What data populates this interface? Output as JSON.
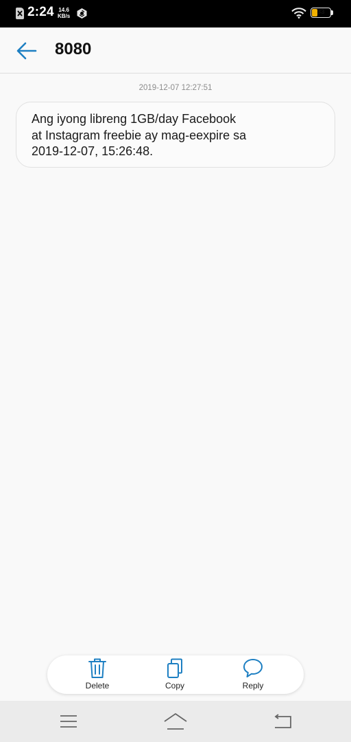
{
  "status_bar": {
    "time": "2:24",
    "speed_value": "14.6",
    "speed_unit": "KB/s",
    "battery_level": "33",
    "battery_fraction": 0.33,
    "battery_color": "#f0b100",
    "icons": [
      "sim-card-icon",
      "app-notification-icon",
      "wifi-icon",
      "battery-icon"
    ]
  },
  "header": {
    "title": "8080",
    "back_icon": "arrow-left-icon",
    "accent_color": "#1d7fc2"
  },
  "conversation": {
    "messages": [
      {
        "timestamp": "2019-12-07 12:27:51",
        "lines": [
          "Ang iyong libreng 1GB/day Facebook",
          "at Instagram freebie ay mag-eexpire sa",
          "2019-12-07, 15:26:48."
        ]
      }
    ]
  },
  "action_bar": {
    "delete_label": "Delete",
    "copy_label": "Copy",
    "reply_label": "Reply",
    "icon_color": "#1d7fc2"
  },
  "nav_bar": {
    "icons": [
      "menu-icon",
      "home-icon",
      "back-icon"
    ]
  }
}
